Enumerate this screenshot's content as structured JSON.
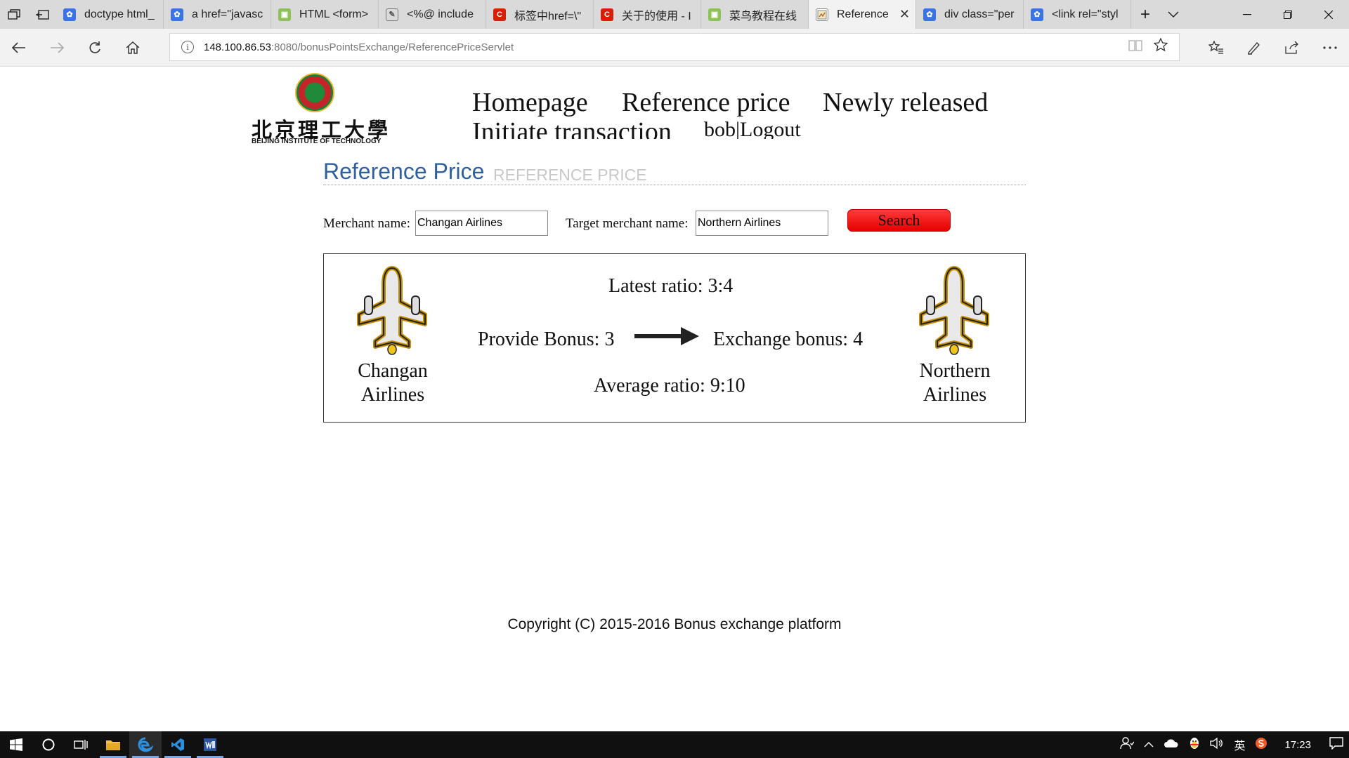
{
  "browser": {
    "tabs": [
      {
        "title": "doctype html_",
        "favicon": "baidu-paw-icon",
        "active": false
      },
      {
        "title": "a href=\"javasc",
        "favicon": "baidu-paw-icon",
        "active": false
      },
      {
        "title": "HTML <form>",
        "favicon": "runoob-icon",
        "active": false
      },
      {
        "title": "<%@ include",
        "favicon": "document-icon",
        "active": false
      },
      {
        "title": "标签中href=\\\"",
        "favicon": "csdn-icon",
        "active": false
      },
      {
        "title": "关于的使用 - I",
        "favicon": "csdn-icon",
        "active": false
      },
      {
        "title": "菜鸟教程在线",
        "favicon": "runoob-icon",
        "active": false
      },
      {
        "title": "Reference",
        "favicon": "page-icon",
        "active": true
      },
      {
        "title": "div class=\"per",
        "favicon": "baidu-paw-icon",
        "active": false
      },
      {
        "title": "<link rel=\"styl",
        "favicon": "baidu-paw-icon",
        "active": false
      }
    ],
    "address": {
      "host": "148.100.86.53",
      "path": ":8080/bonusPointsExchange/ReferencePriceServlet"
    }
  },
  "site": {
    "logo": {
      "chinese_name": "北京理工大學",
      "english_name": "BEIJING INSTITUTE OF TECHNOLOGY"
    },
    "nav": {
      "homepage": "Homepage",
      "reference_price": "Reference price",
      "newly_released": "Newly released",
      "initiate_transaction": "Initiate transaction",
      "username": "bob",
      "separator": "|",
      "logout": "Logout"
    }
  },
  "main": {
    "title": "Reference Price",
    "subtitle": "REFERENCE PRICE",
    "search": {
      "merchant_label": "Merchant name:",
      "merchant_value": "Changan Airlines",
      "target_label": "Target merchant name:",
      "target_value": "Northern Airlines",
      "button_label": "Search"
    },
    "result": {
      "source_merchant_line1": "Changan",
      "source_merchant_line2": "Airlines",
      "target_merchant_line1": "Northern",
      "target_merchant_line2": "Airlines",
      "latest_ratio": "Latest ratio: 3:4",
      "provide_bonus": "Provide Bonus: 3",
      "exchange_bonus": "Exchange bonus: 4",
      "average_ratio": "Average ratio: 9:10"
    }
  },
  "footer": {
    "copyright": "Copyright (C) 2015-2016 Bonus exchange platform"
  },
  "taskbar": {
    "clock": "17:23",
    "ime": "英"
  }
}
